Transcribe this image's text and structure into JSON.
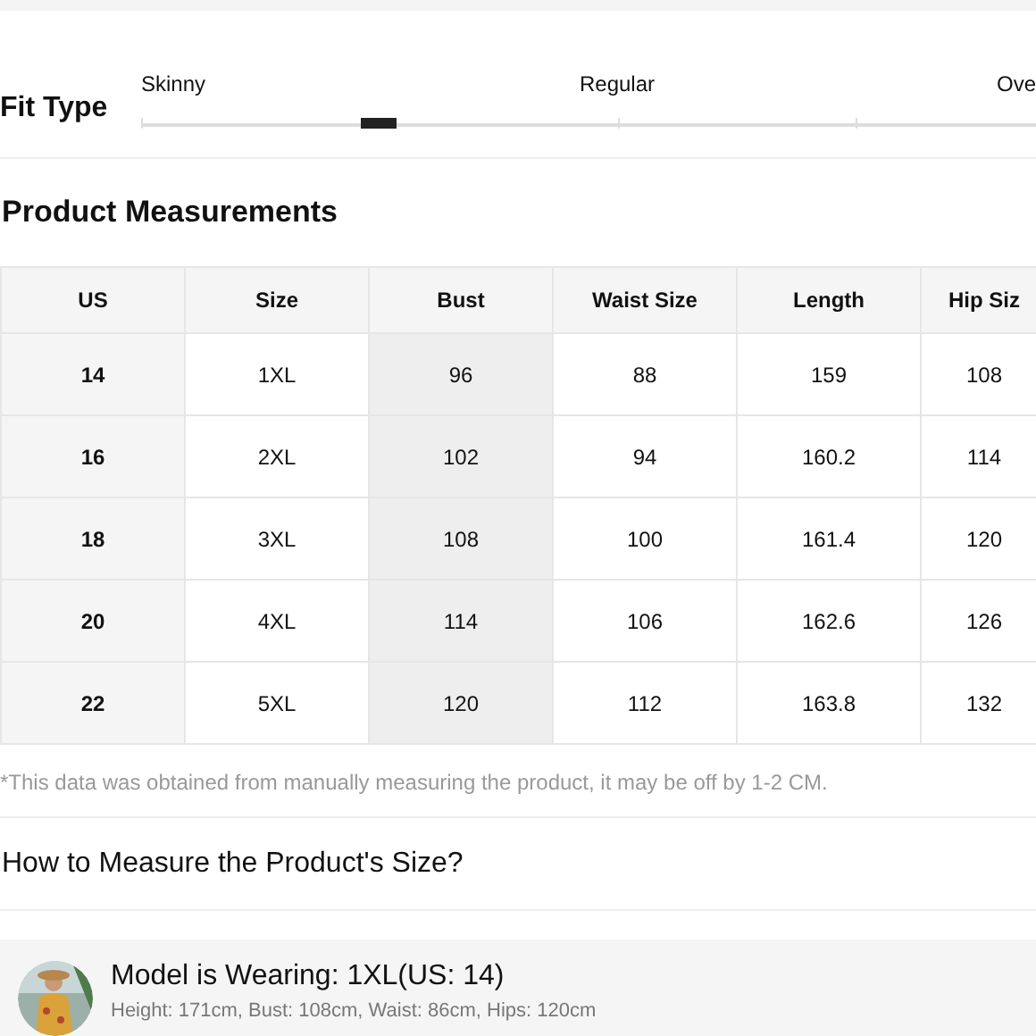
{
  "fit_type": {
    "label": "Fit Type",
    "scale_labels": [
      "Skinny",
      "Regular",
      "Ove"
    ],
    "level": 0.25
  },
  "measurements": {
    "title": "Product Measurements",
    "columns": [
      {
        "label": "US",
        "highlighted": false
      },
      {
        "label": "Size",
        "highlighted": false
      },
      {
        "label": "Bust",
        "highlighted": true
      },
      {
        "label": "Waist Size",
        "highlighted": false
      },
      {
        "label": "Length",
        "highlighted": false
      },
      {
        "label": "Hip Siz",
        "highlighted": false
      }
    ],
    "rows": [
      [
        "14",
        "1XL",
        "96",
        "88",
        "159",
        "108"
      ],
      [
        "16",
        "2XL",
        "102",
        "94",
        "160.2",
        "114"
      ],
      [
        "18",
        "3XL",
        "108",
        "100",
        "161.4",
        "120"
      ],
      [
        "20",
        "4XL",
        "114",
        "106",
        "162.6",
        "126"
      ],
      [
        "22",
        "5XL",
        "120",
        "112",
        "163.8",
        "132"
      ]
    ],
    "note": "*This data was obtained from manually measuring the product, it may be off by 1-2 CM."
  },
  "how_to_measure": {
    "title": "How to Measure the Product's Size?"
  },
  "model": {
    "wearing": "Model is Wearing: 1XL(US: 14)",
    "stats": "Height: 171cm, Bust: 108cm, Waist: 86cm, Hips: 120cm"
  }
}
